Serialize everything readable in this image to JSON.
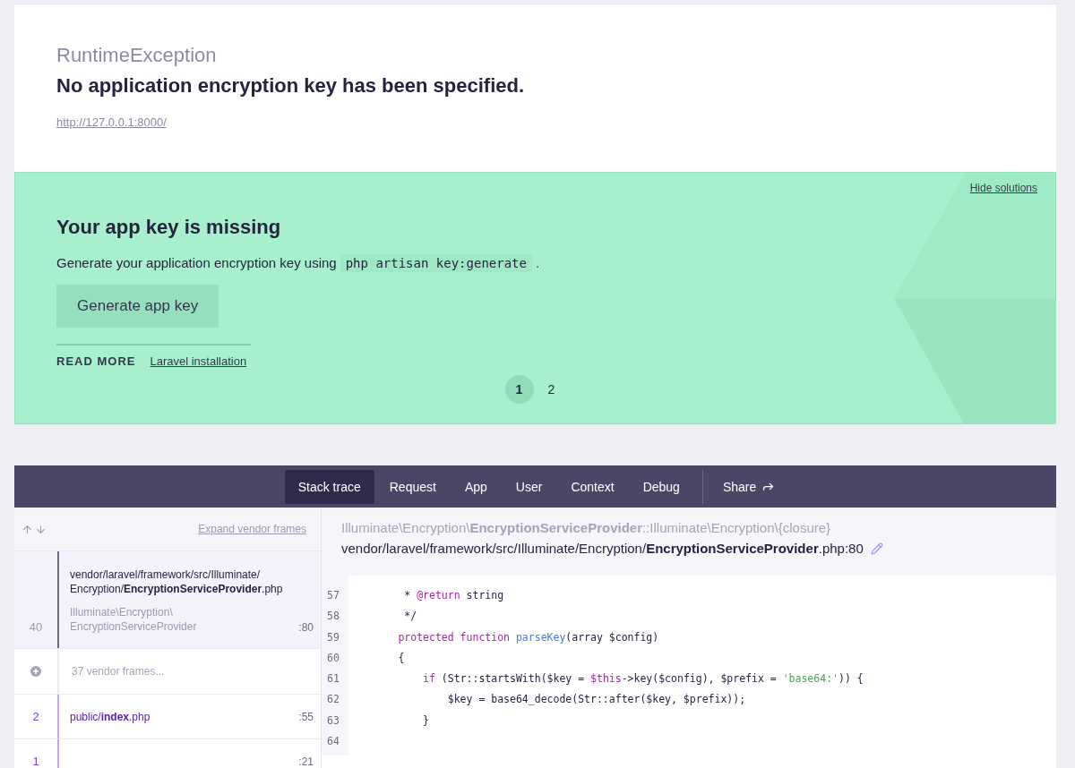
{
  "exception": {
    "class": "RuntimeException",
    "message": "No application encryption key has been specified.",
    "url": "http://127.0.0.1:8000/"
  },
  "solution": {
    "hide_label": "Hide solutions",
    "title": "Your app key is missing",
    "description_before": "Generate your application encryption key using",
    "command": "php artisan key:generate",
    "description_after": ".",
    "button": "Generate app key",
    "read_more_label": "READ MORE",
    "links": [
      "Laravel installation"
    ],
    "pages": [
      {
        "label": "1",
        "selected": true
      },
      {
        "label": "2",
        "selected": false
      }
    ]
  },
  "tabs": [
    {
      "label": "Stack trace",
      "selected": true
    },
    {
      "label": "Request",
      "selected": false
    },
    {
      "label": "App",
      "selected": false
    },
    {
      "label": "User",
      "selected": false
    },
    {
      "label": "Context",
      "selected": false
    },
    {
      "label": "Debug",
      "selected": false
    }
  ],
  "share": {
    "label": "Share"
  },
  "sidebar": {
    "expand_label": "Expand vendor frames",
    "frames": [
      {
        "kind": "frame",
        "number": "40",
        "file": "vendor/laravel/framework/src/Illuminate/ Encryption/**EncryptionServiceProvider**.php",
        "class": "Illuminate\\Encryption\\ EncryptionServiceProvider",
        "line": ":80",
        "selected": true,
        "vendor": true
      },
      {
        "kind": "collapsed",
        "label": "37 vendor frames..."
      },
      {
        "kind": "frame",
        "number": "2",
        "file": "public/**index**.php",
        "line": ":55",
        "selected": false,
        "vendor": false
      },
      {
        "kind": "frame",
        "number": "1",
        "line": ":21",
        "selected": false,
        "vendor": false
      }
    ]
  },
  "detail": {
    "signature": "Illuminate\\Encryption\\**EncryptionServiceProvider**::Illuminate\\Encryption\\{closure}",
    "file": "vendor/laravel/framework/src/Illuminate/Encryption/**EncryptionServiceProvider**.php:80",
    "code": [
      {
        "number": "57",
        "tokens": [
          {
            "kind": "plain",
            "text": "         * "
          },
          {
            "kind": "keyword",
            "text": "@return"
          },
          {
            "kind": "plain",
            "text": " string"
          }
        ]
      },
      {
        "number": "58",
        "tokens": [
          {
            "kind": "plain",
            "text": "         */"
          }
        ]
      },
      {
        "number": "59",
        "tokens": [
          {
            "kind": "keyword",
            "text": "        protected function "
          },
          {
            "kind": "function",
            "text": "parseKey"
          },
          {
            "kind": "plain",
            "text": "(array $config)"
          }
        ]
      },
      {
        "number": "60",
        "tokens": [
          {
            "kind": "plain",
            "text": "        {"
          }
        ]
      },
      {
        "number": "61",
        "tokens": [
          {
            "kind": "keyword",
            "text": "            if"
          },
          {
            "kind": "plain",
            "text": " (Str::startsWith($key = "
          },
          {
            "kind": "keyword",
            "text": "$this"
          },
          {
            "kind": "plain",
            "text": "->key($config), $prefix = "
          },
          {
            "kind": "string",
            "text": "'base64:'"
          },
          {
            "kind": "plain",
            "text": ")) {"
          }
        ]
      },
      {
        "number": "62",
        "tokens": [
          {
            "kind": "plain",
            "text": "                $key = base64_decode(Str::after($key, $prefix));"
          }
        ]
      },
      {
        "number": "63",
        "tokens": [
          {
            "kind": "plain",
            "text": "            }"
          }
        ]
      },
      {
        "number": "64"
      }
    ]
  }
}
